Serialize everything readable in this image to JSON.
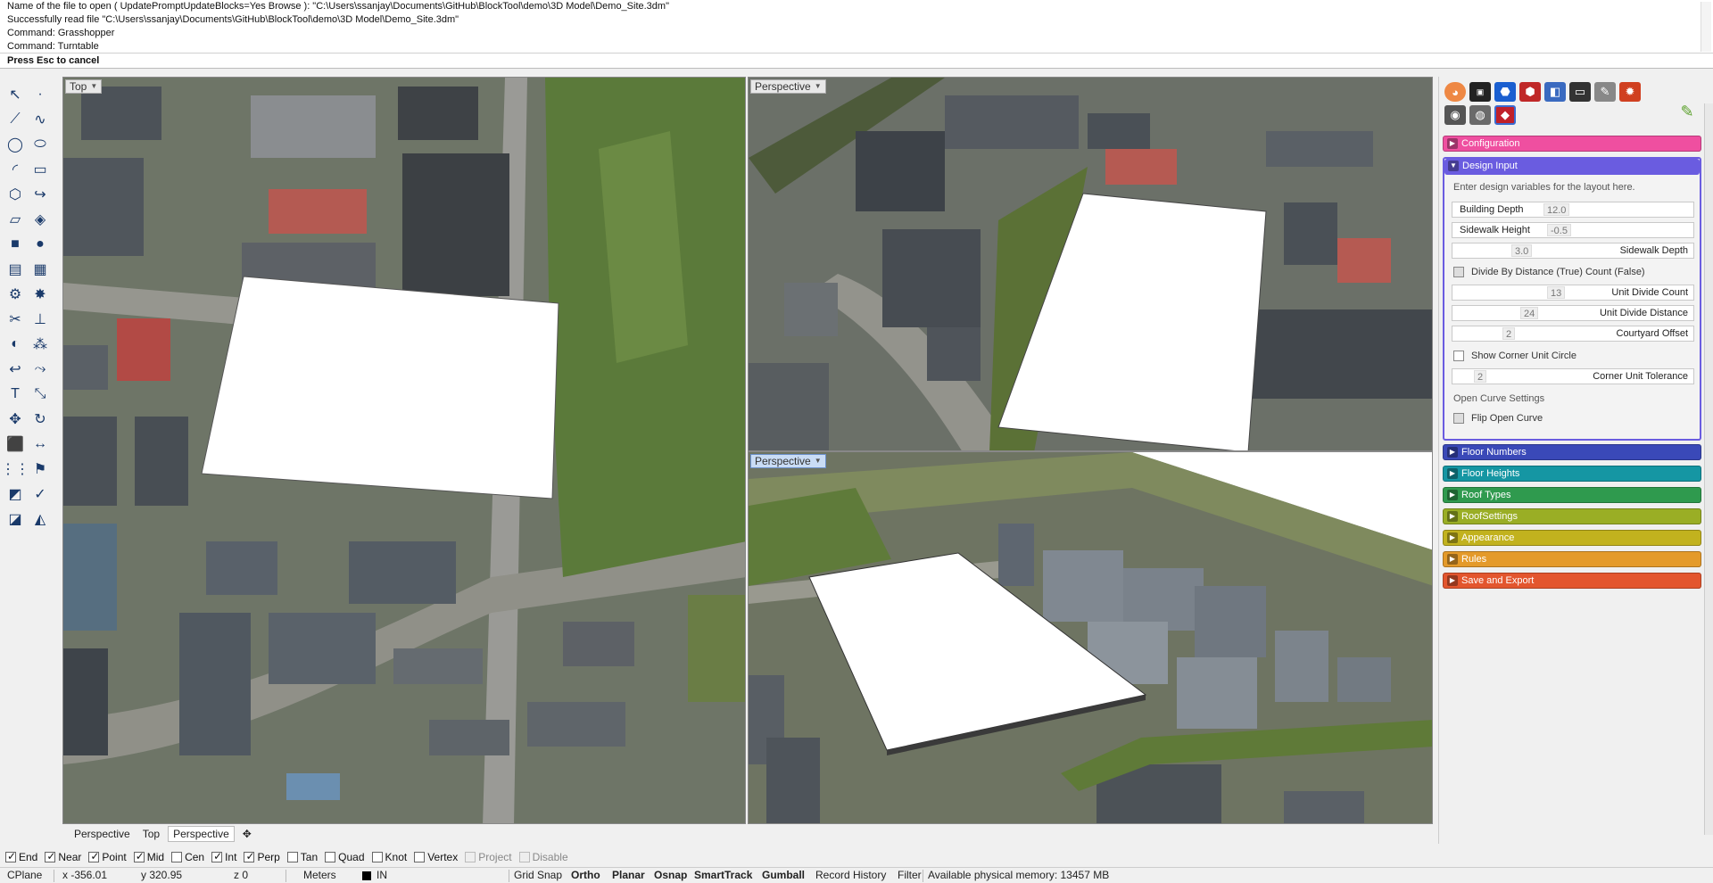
{
  "command_history": [
    "Name of the file to open ( UpdatePromptUpdateBlocks=Yes  Browse ): \"C:\\Users\\ssanjay\\Documents\\GitHub\\BlockTool\\demo\\3D Model\\Demo_Site.3dm\"",
    "Successfully read file \"C:\\Users\\ssanjay\\Documents\\GitHub\\BlockTool\\demo\\3D Model\\Demo_Site.3dm\"",
    "Command: Grasshopper",
    "Command: Turntable"
  ],
  "command_prompt": "Press Esc to cancel",
  "viewports": {
    "top": "Top",
    "persp_top": "Perspective",
    "persp_bottom": "Perspective"
  },
  "viewport_tabs": [
    "Perspective",
    "Top",
    "Perspective"
  ],
  "viewport_tab_add": "✥",
  "panel": {
    "sections": {
      "configuration": "Configuration",
      "design_input": "Design Input",
      "floor_numbers": "Floor Numbers",
      "floor_heights": "Floor Heights",
      "roof_types": "Roof Types",
      "roof_settings": "RoofSettings",
      "appearance": "Appearance",
      "rules": "Rules",
      "save_export": "Save and Export"
    },
    "design_input": {
      "hint": "Enter design variables for the layout here.",
      "building_depth_label": "Building Depth",
      "building_depth_value": "12.0",
      "sidewalk_height_label": "Sidewalk Height",
      "sidewalk_height_value": "-0.5",
      "sidewalk_depth_label": "Sidewalk Depth",
      "sidewalk_depth_value": "3.0",
      "divide_by_label": "Divide By Distance (True) Count (False)",
      "unit_divide_count_label": "Unit Divide Count",
      "unit_divide_count_value": "13",
      "unit_divide_distance_label": "Unit Divide Distance",
      "unit_divide_distance_value": "24",
      "courtyard_offset_label": "Courtyard Offset",
      "courtyard_offset_value": "2",
      "show_corner_label": "Show Corner Unit Circle",
      "corner_tolerance_label": "Corner Unit Tolerance",
      "corner_tolerance_value": "2",
      "open_curve_label": "Open Curve Settings",
      "flip_open_curve_label": "Flip Open Curve"
    },
    "colors": {
      "configuration": "#ef4fa0",
      "design_input": "#6a5ce0",
      "floor_numbers": "#3a49b8",
      "floor_heights": "#1596a3",
      "roof_types": "#2f9a4e",
      "roof_settings": "#9aae25",
      "appearance": "#c2b21e",
      "rules": "#e49a2a",
      "save_export": "#e3562e"
    }
  },
  "osnaps": [
    {
      "label": "End",
      "checked": true
    },
    {
      "label": "Near",
      "checked": true
    },
    {
      "label": "Point",
      "checked": true
    },
    {
      "label": "Mid",
      "checked": true
    },
    {
      "label": "Cen",
      "checked": false
    },
    {
      "label": "Int",
      "checked": true
    },
    {
      "label": "Perp",
      "checked": true
    },
    {
      "label": "Tan",
      "checked": false
    },
    {
      "label": "Quad",
      "checked": false
    },
    {
      "label": "Knot",
      "checked": false
    },
    {
      "label": "Vertex",
      "checked": false
    },
    {
      "label": "Project",
      "checked": false,
      "disabled": true
    },
    {
      "label": "Disable",
      "checked": false,
      "disabled": true
    }
  ],
  "status": {
    "cplane": "CPlane",
    "x": "x -356.01",
    "y": "y 320.95",
    "z": "z 0",
    "units": "Meters",
    "layer": "IN",
    "grid_snap": "Grid Snap",
    "ortho": "Ortho",
    "planar": "Planar",
    "osnap": "Osnap",
    "smarttrack": "SmartTrack",
    "gumball": "Gumball",
    "record_history": "Record History",
    "filter": "Filter",
    "memory": "Available physical memory: 13457 MB"
  }
}
